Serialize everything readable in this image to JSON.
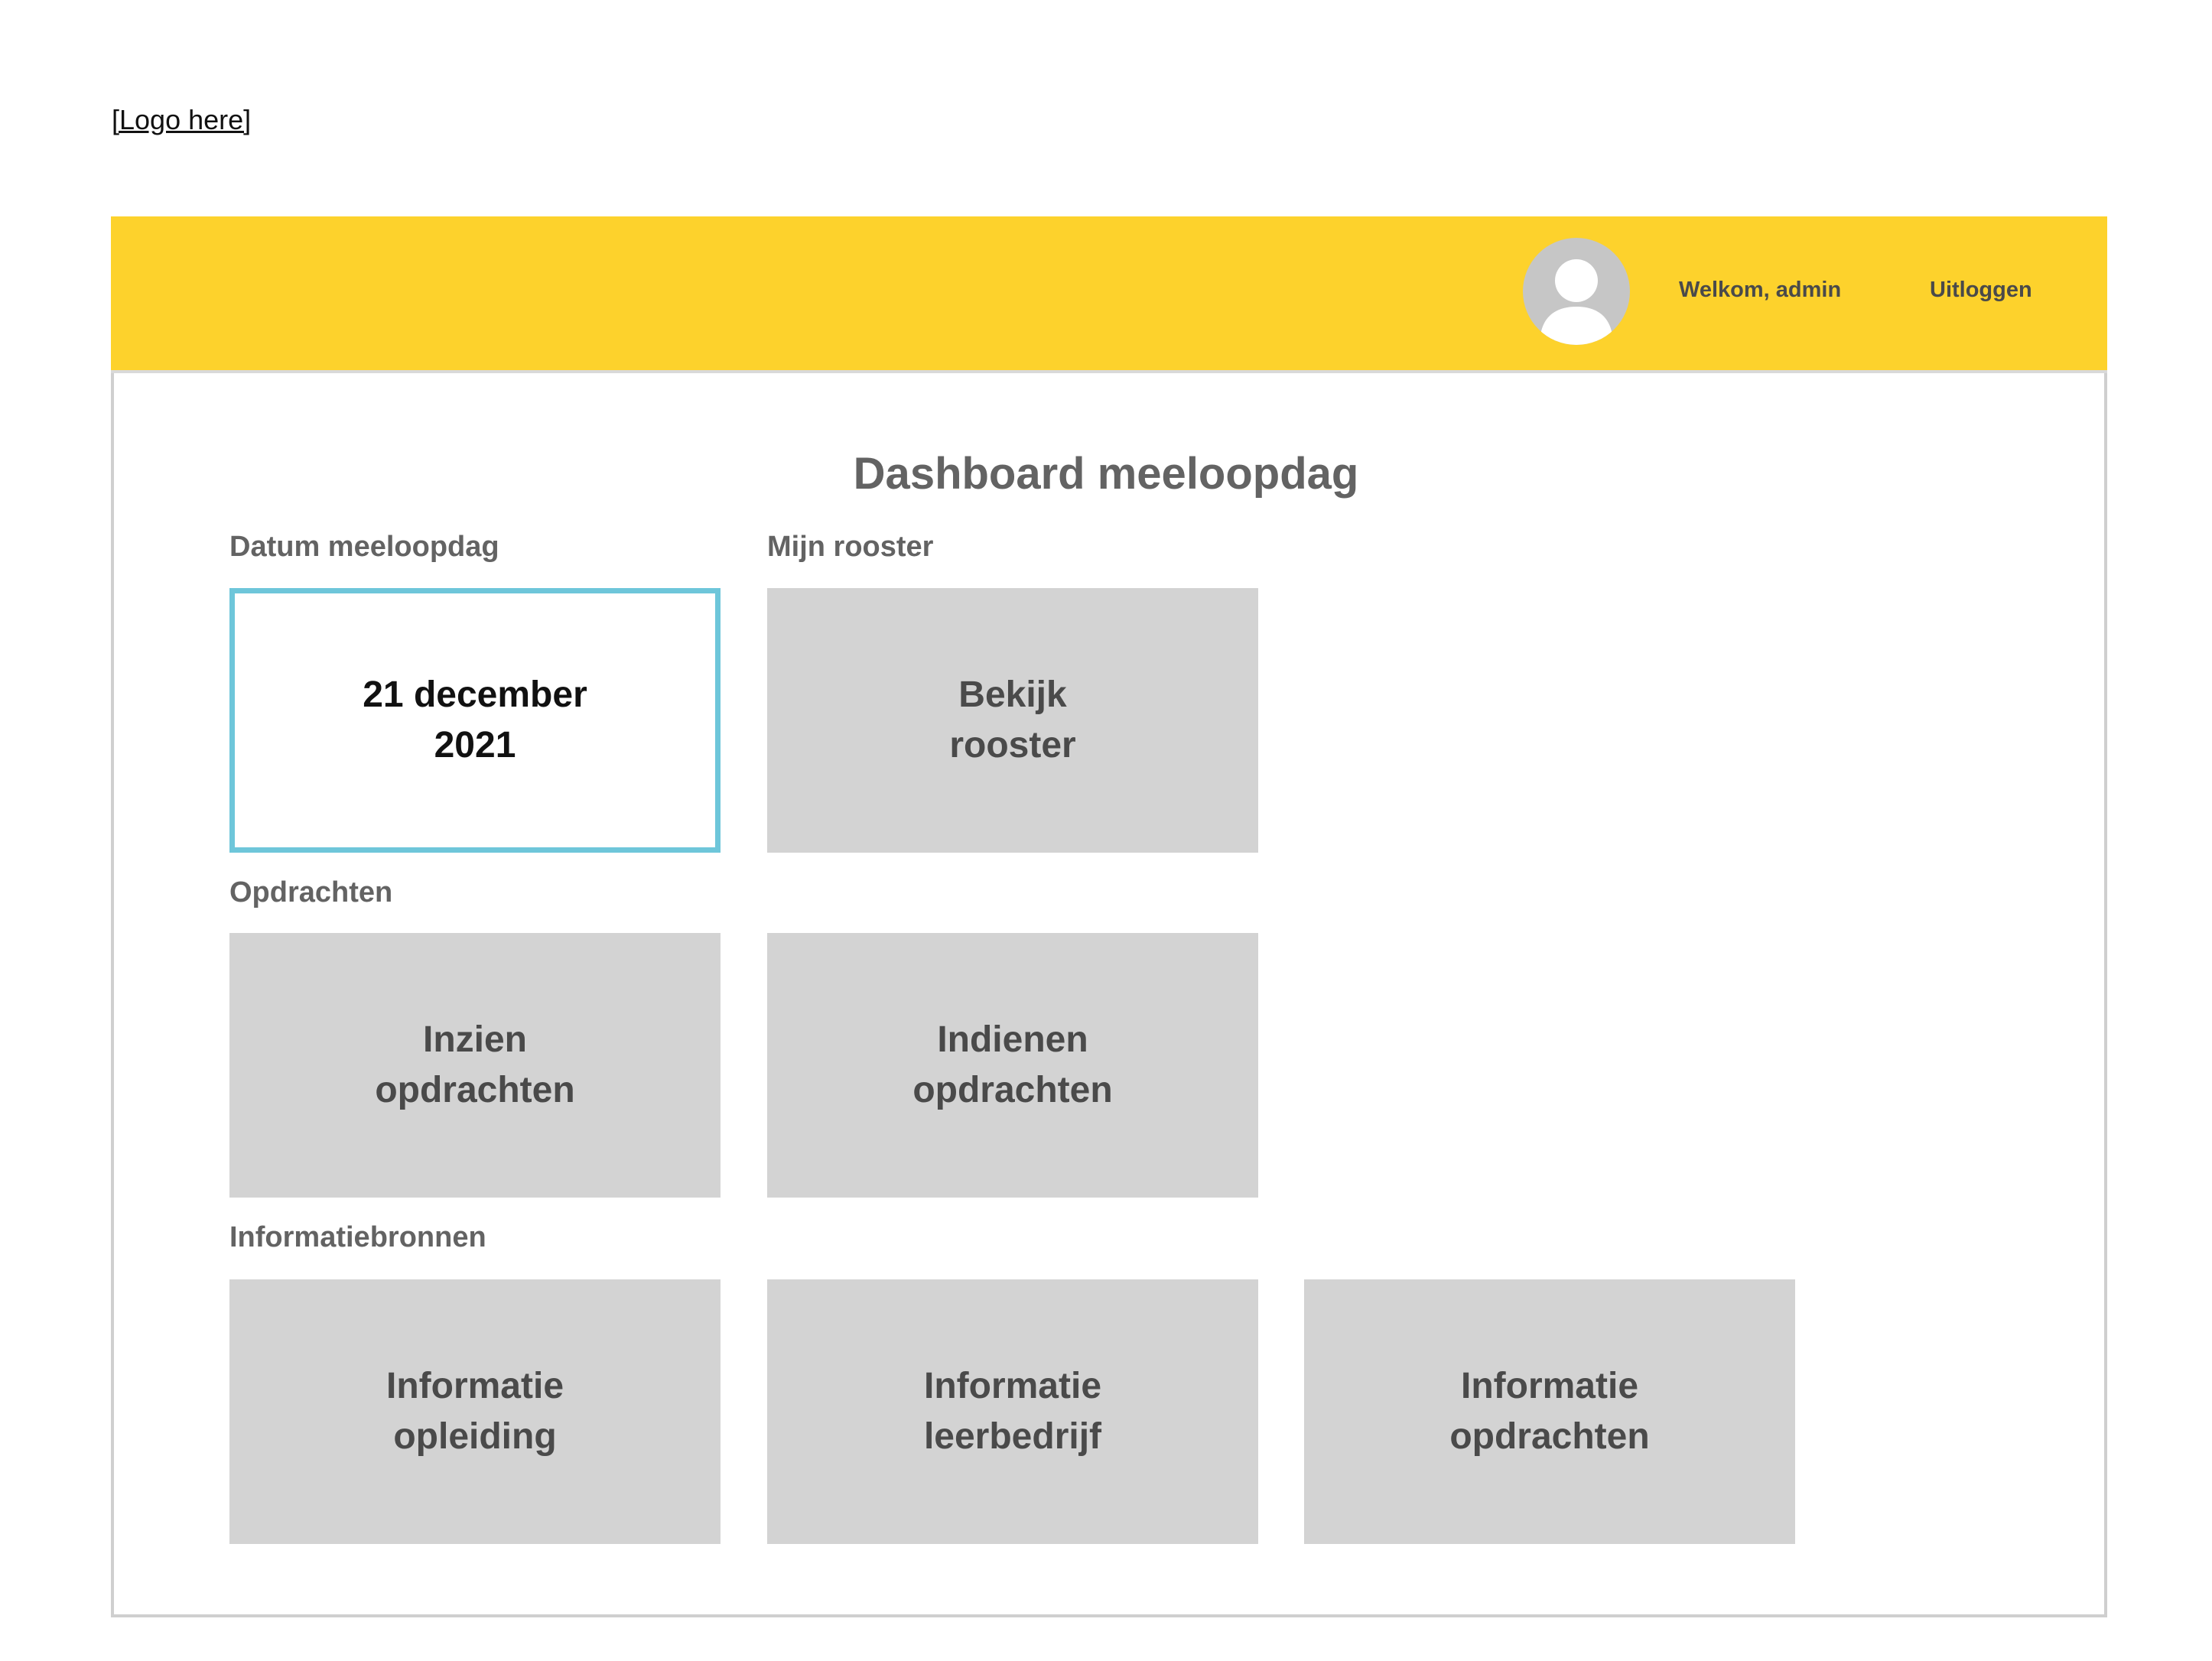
{
  "logo": {
    "label": "[Logo here]"
  },
  "header": {
    "welcome": "Welkom, admin",
    "logout": "Uitloggen",
    "color": "#fdd22c"
  },
  "main": {
    "title": "Dashboard meeloopdag",
    "sections": {
      "date": {
        "label": "Datum meeloopdag",
        "line1": "21 december",
        "line2": "2021",
        "border_color": "#6ec6da"
      },
      "schedule": {
        "label": "Mijn rooster",
        "line1": "Bekijk",
        "line2": "rooster"
      },
      "assignments": {
        "label": "Opdrachten",
        "tiles": [
          {
            "line1": "Inzien",
            "line2": "opdrachten"
          },
          {
            "line1": "Indienen",
            "line2": "opdrachten"
          }
        ]
      },
      "sources": {
        "label": "Informatiebronnen",
        "tiles": [
          {
            "line1": "Informatie",
            "line2": "opleiding"
          },
          {
            "line1": "Informatie",
            "line2": "leerbedrijf"
          },
          {
            "line1": "Informatie",
            "line2": "opdrachten"
          }
        ]
      }
    }
  },
  "icons": {
    "avatar": "user-avatar-icon"
  }
}
